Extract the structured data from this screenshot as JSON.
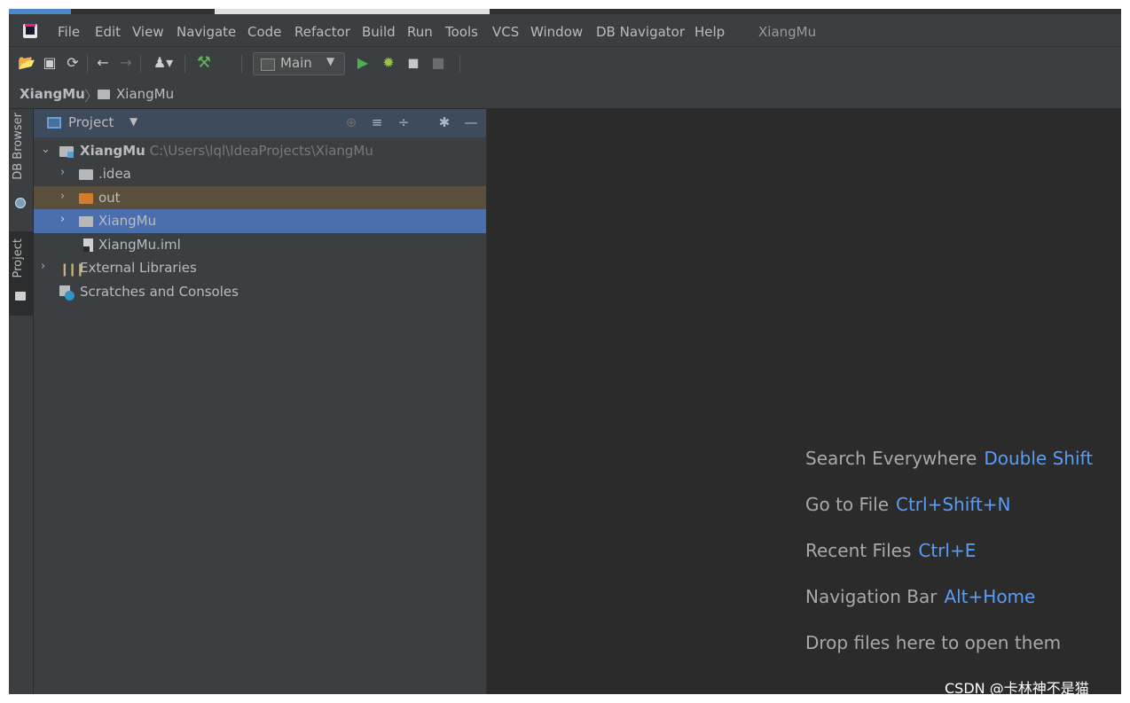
{
  "menu": {
    "items": [
      "File",
      "Edit",
      "View",
      "Navigate",
      "Code",
      "Refactor",
      "Build",
      "Run",
      "Tools",
      "VCS",
      "Window",
      "DB Navigator",
      "Help"
    ],
    "project_title": "XiangMu"
  },
  "toolbar": {
    "run_config": "Main",
    "icons": [
      "open-icon",
      "save-icon",
      "sync-icon",
      "back-icon",
      "forward-icon",
      "user-icon",
      "build-hammer-icon",
      "run-icon",
      "debug-icon",
      "coverage-icon",
      "stop-icon"
    ],
    "colors": {
      "run": "#4caf50",
      "debug": "#9bc34a",
      "build": "#5db855"
    }
  },
  "breadcrumb": {
    "root": "XiangMu",
    "child": "XiangMu"
  },
  "sidebar": {
    "db_browser": "DB Browser",
    "project": "Project"
  },
  "project_panel": {
    "title": "Project",
    "tree": {
      "root_name": "XiangMu",
      "root_path": "C:\\Users\\lql\\IdeaProjects\\XiangMu",
      "idea": ".idea",
      "out": "out",
      "module": "XiangMu",
      "iml": "XiangMu.iml",
      "libraries": "External Libraries",
      "scratches": "Scratches and Consoles"
    },
    "selected_item": "XiangMu",
    "colors": {
      "selection": "#4b6eaf",
      "excluded": "#5a4f3b"
    }
  },
  "editor": {
    "hints": [
      {
        "text": "Search Everywhere",
        "key": "Double Shift"
      },
      {
        "text": "Go to File",
        "key": "Ctrl+Shift+N"
      },
      {
        "text": "Recent Files",
        "key": "Ctrl+E"
      },
      {
        "text": "Navigation Bar",
        "key": "Alt+Home"
      },
      {
        "text": "Drop files here to open them",
        "key": ""
      }
    ],
    "key_color": "#589df6"
  },
  "watermark": "CSDN @卡林神不是猫"
}
